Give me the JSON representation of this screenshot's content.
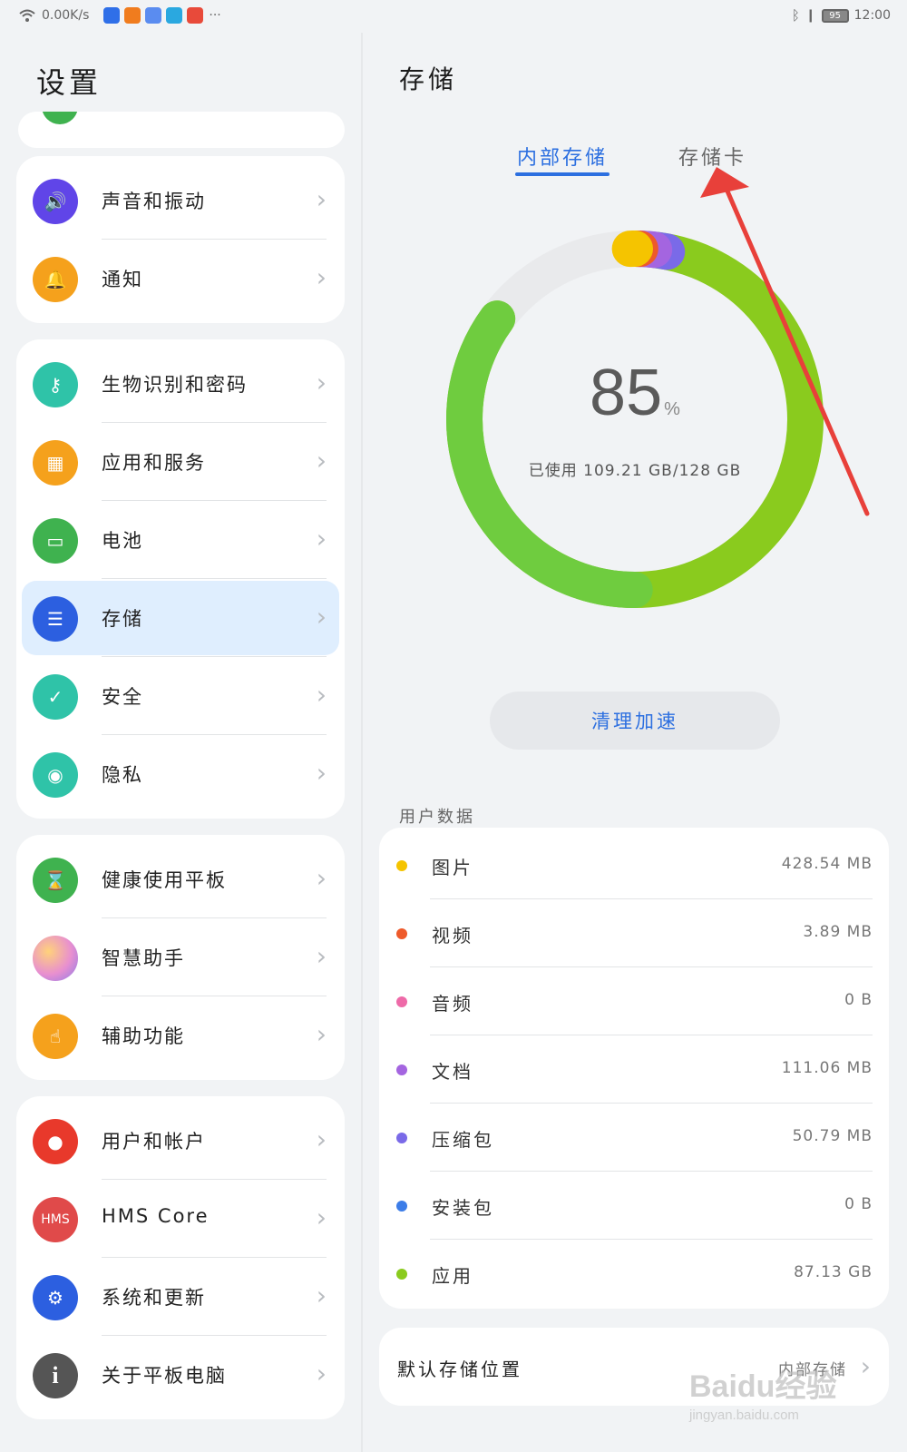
{
  "status_bar": {
    "network_speed": "0.00K/s",
    "more": "···",
    "battery": "95",
    "time": "12:00",
    "app_icon_colors": [
      "#2f6fe8",
      "#f07c1e",
      "#5a8cf0",
      "#2aa8e0",
      "#e84a3a"
    ]
  },
  "left": {
    "title": "设置",
    "groups": [
      [
        {
          "label": "声音和振动",
          "icon": "speaker-icon",
          "color": "#6045e8"
        },
        {
          "label": "通知",
          "icon": "bell-icon",
          "color": "#f5a11c"
        }
      ],
      [
        {
          "label": "生物识别和密码",
          "icon": "key-icon",
          "color": "#2fc3a8"
        },
        {
          "label": "应用和服务",
          "icon": "apps-grid-icon",
          "color": "#f5a11c"
        },
        {
          "label": "电池",
          "icon": "battery-icon",
          "color": "#3fb24f"
        },
        {
          "label": "存储",
          "icon": "storage-icon",
          "color": "#2c5fe0",
          "selected": true
        },
        {
          "label": "安全",
          "icon": "shield-check-icon",
          "color": "#2fc3a8"
        },
        {
          "label": "隐私",
          "icon": "privacy-shield-icon",
          "color": "#2fc3a8"
        }
      ],
      [
        {
          "label": "健康使用平板",
          "icon": "hourglass-icon",
          "color": "#3fb24f"
        },
        {
          "label": "智慧助手",
          "icon": "assistant-orb-icon",
          "color": "#e88fd0"
        },
        {
          "label": "辅助功能",
          "icon": "hand-icon",
          "color": "#f5a11c"
        }
      ],
      [
        {
          "label": "用户和帐户",
          "icon": "user-icon",
          "color": "#e8392b"
        },
        {
          "label": "HMS Core",
          "icon": "hms-icon",
          "color": "#e04a4a",
          "icon_text": "HMS"
        },
        {
          "label": "系统和更新",
          "icon": "gear-icon",
          "color": "#2c5fe0"
        },
        {
          "label": "关于平板电脑",
          "icon": "info-icon",
          "color": "#555555"
        }
      ]
    ]
  },
  "right": {
    "title": "存储",
    "tabs": [
      {
        "label": "内部存储",
        "active": true
      },
      {
        "label": "存储卡",
        "active": false
      }
    ],
    "usage": {
      "percent": "85",
      "percent_unit": "%",
      "percent_value": 85,
      "used_text": "已使用  109.21 GB/128 GB"
    },
    "clean_button": "清理加速",
    "section_label": "用户数据",
    "items": [
      {
        "label": "图片",
        "value": "428.54 MB",
        "color": "#f5c400"
      },
      {
        "label": "视频",
        "value": "3.89 MB",
        "color": "#ee5a2a"
      },
      {
        "label": "音频",
        "value": "0 B",
        "color": "#ee6aa8"
      },
      {
        "label": "文档",
        "value": "111.06 MB",
        "color": "#a465e0"
      },
      {
        "label": "压缩包",
        "value": "50.79 MB",
        "color": "#7a6ae8"
      },
      {
        "label": "安装包",
        "value": "0 B",
        "color": "#3c7de8"
      },
      {
        "label": "应用",
        "value": "87.13 GB",
        "color": "#8acb1e"
      }
    ],
    "default_location": {
      "label": "默认存储位置",
      "value": "内部存储"
    }
  },
  "watermark": {
    "main": "Baidu经验",
    "sub": "jingyan.baidu.com"
  },
  "colors": {
    "accent": "#2c6fe0",
    "annotation_arrow": "#e8403a"
  }
}
